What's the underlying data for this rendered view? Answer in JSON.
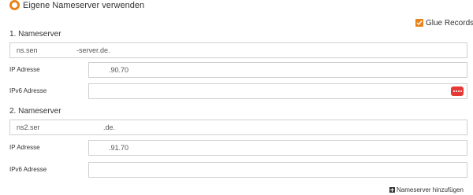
{
  "own_nameserver": {
    "label": "Eigene Nameserver verwenden",
    "selected": true
  },
  "glue_records": {
    "label": "Glue Records",
    "checked": true
  },
  "nameserver1": {
    "title": "1. Nameserver",
    "host_part1": "ns.sen",
    "host_part2": "-server.de.",
    "ip_label": "IP Adresse",
    "ip_value": ".90.70",
    "ipv6_label": "IPv6 Adresse",
    "ipv6_value": ""
  },
  "nameserver2": {
    "title": "2. Nameserver",
    "host_part1": "ns2.ser",
    "host_part2": ".de.",
    "ip_label": "IP Adresse",
    "ip_value": ".91.70",
    "ipv6_label": "IPv6 Adresse",
    "ipv6_value": ""
  },
  "add_nameserver": {
    "label": "Nameserver hinzufügen"
  },
  "colors": {
    "accent": "#e8831b",
    "password_button": "#e53935",
    "border": "#d0d0d0"
  }
}
